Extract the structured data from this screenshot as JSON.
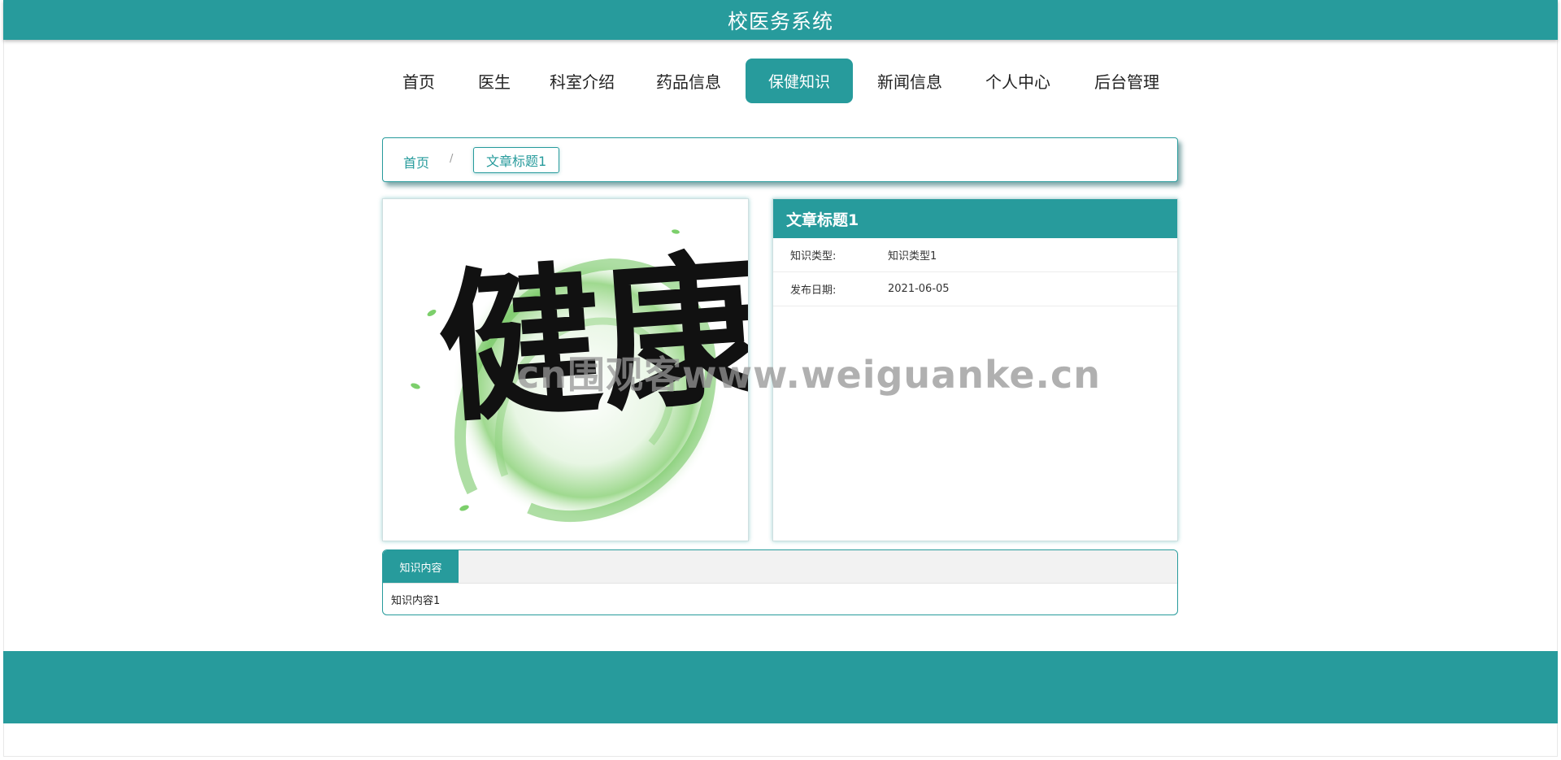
{
  "header": {
    "title": "校医务系统"
  },
  "nav": {
    "items": [
      {
        "label": "首页",
        "active": false
      },
      {
        "label": "医生",
        "active": false
      },
      {
        "label": "科室介绍",
        "active": false
      },
      {
        "label": "药品信息",
        "active": false
      },
      {
        "label": "保健知识",
        "active": true
      },
      {
        "label": "新闻信息",
        "active": false
      },
      {
        "label": "个人中心",
        "active": false
      },
      {
        "label": "后台管理",
        "active": false
      }
    ]
  },
  "breadcrumb": {
    "home": "首页",
    "separator": "/",
    "current": "文章标题1"
  },
  "article": {
    "title": "文章标题1",
    "fields": [
      {
        "label": "知识类型:",
        "value": "知识类型1"
      },
      {
        "label": "发布日期:",
        "value": "2021-06-05"
      }
    ],
    "image_text": "健康"
  },
  "content": {
    "tab_label": "知识内容",
    "text": "知识内容1"
  },
  "watermark": "cn围观客www.weiguanke.cn",
  "colors": {
    "accent": "#279b9c"
  }
}
